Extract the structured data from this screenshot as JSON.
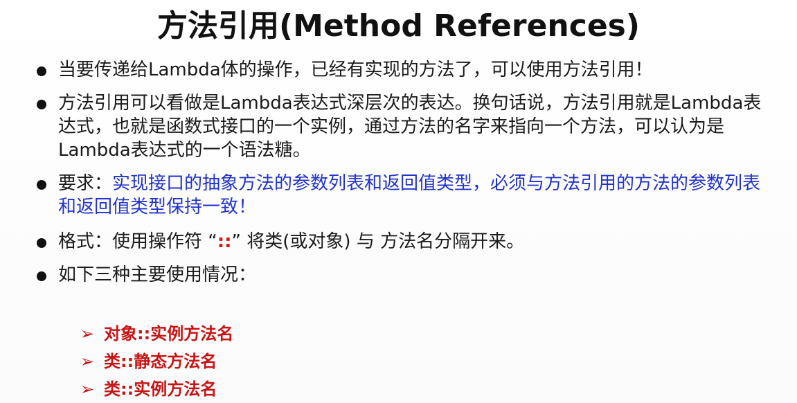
{
  "slide": {
    "title": "方法引用(Method References)",
    "bullets": [
      {
        "text": "当要传递给Lambda体的操作，已经有实现的方法了，可以使用方法引用！"
      },
      {
        "text": "方法引用可以看做是Lambda表达式深层次的表达。换句话说，方法引用就是Lambda表达式，也就是函数式接口的一个实例，通过方法的名字来指向一个方法，可以认为是Lambda表达式的一个语法糖。"
      },
      {
        "prefix": "要求：",
        "highlight": "实现接口的抽象方法的参数列表和返回值类型，必须与方法引用的方法的参数列表和返回值类型保持一致！"
      },
      {
        "prefix": "格式：使用操作符 “",
        "op": "::",
        "suffix": "” 将类(或对象) 与 方法名分隔开来。"
      },
      {
        "text": "如下三种主要使用情况："
      }
    ],
    "cases": [
      {
        "arrow": "➢",
        "label": "对象::实例方法名"
      },
      {
        "arrow": "➢",
        "label": "类::静态方法名"
      },
      {
        "arrow": "➢",
        "label": "类::实例方法名"
      }
    ]
  }
}
